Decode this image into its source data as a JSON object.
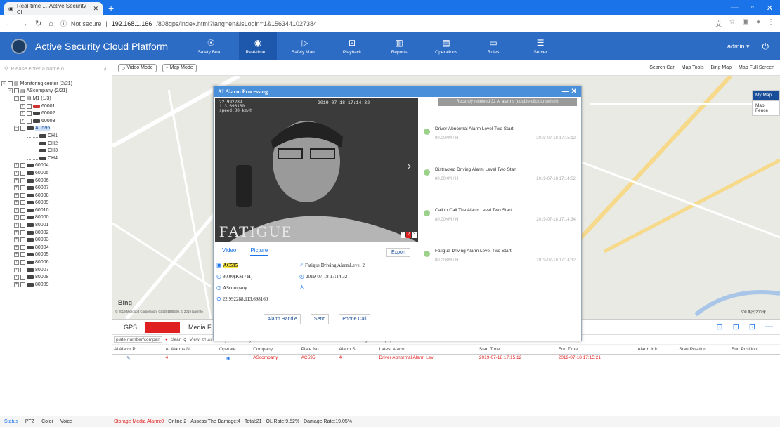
{
  "browser": {
    "tab_title": "Real-time ...-Active Security Cl",
    "url_prefix": "Not secure",
    "url_host": "192.168.1.166",
    "url_path": "/808gps/index.html?lang=en&isLogin=1&1563441027384"
  },
  "app": {
    "title": "Active Security Cloud Platform",
    "user": "admin"
  },
  "nav": [
    {
      "label": "Safety Boa...",
      "icon": "☉"
    },
    {
      "label": "Real-time ...",
      "icon": "◉"
    },
    {
      "label": "Safety Man...",
      "icon": "▷"
    },
    {
      "label": "Playback",
      "icon": "⊡"
    },
    {
      "label": "Reports",
      "icon": "▥"
    },
    {
      "label": "Operations",
      "icon": "▤"
    },
    {
      "label": "Rules",
      "icon": "▭"
    },
    {
      "label": "Server",
      "icon": "☰"
    }
  ],
  "sidebar": {
    "search_placeholder": "Please enter a name o",
    "tree": [
      {
        "t": "Monitoring center (2/21)",
        "lvl": 0,
        "type": "root"
      },
      {
        "t": "AScompany (2/21)",
        "lvl": 1,
        "type": "grp"
      },
      {
        "t": "M1 (1/3)",
        "lvl": 2,
        "type": "grp"
      },
      {
        "t": "60001",
        "lvl": 3,
        "type": "car",
        "red": true
      },
      {
        "t": "60002",
        "lvl": 3,
        "type": "car"
      },
      {
        "t": "60003",
        "lvl": 3,
        "type": "car"
      },
      {
        "t": "AC595",
        "lvl": 2,
        "type": "car",
        "sel": true
      },
      {
        "t": "CH1",
        "lvl": 4,
        "type": "ch"
      },
      {
        "t": "CH2",
        "lvl": 4,
        "type": "ch"
      },
      {
        "t": "CH3",
        "lvl": 4,
        "type": "ch"
      },
      {
        "t": "CH4",
        "lvl": 4,
        "type": "ch"
      },
      {
        "t": "60004",
        "lvl": 2,
        "type": "car"
      },
      {
        "t": "60005",
        "lvl": 2,
        "type": "car"
      },
      {
        "t": "60006",
        "lvl": 2,
        "type": "car"
      },
      {
        "t": "60007",
        "lvl": 2,
        "type": "car"
      },
      {
        "t": "60008",
        "lvl": 2,
        "type": "car"
      },
      {
        "t": "60009",
        "lvl": 2,
        "type": "car"
      },
      {
        "t": "60010",
        "lvl": 2,
        "type": "car"
      },
      {
        "t": "80000",
        "lvl": 2,
        "type": "car"
      },
      {
        "t": "80001",
        "lvl": 2,
        "type": "car"
      },
      {
        "t": "80002",
        "lvl": 2,
        "type": "car"
      },
      {
        "t": "80003",
        "lvl": 2,
        "type": "car"
      },
      {
        "t": "80004",
        "lvl": 2,
        "type": "car"
      },
      {
        "t": "80005",
        "lvl": 2,
        "type": "car"
      },
      {
        "t": "80006",
        "lvl": 2,
        "type": "car"
      },
      {
        "t": "80007",
        "lvl": 2,
        "type": "car"
      },
      {
        "t": "80008",
        "lvl": 2,
        "type": "car"
      },
      {
        "t": "80009",
        "lvl": 2,
        "type": "car"
      }
    ],
    "bottom_tabs": [
      "Status",
      "PTZ",
      "Color",
      "Voice"
    ]
  },
  "maptools": {
    "video_mode": "Video Mode",
    "map_mode": "Map Mode",
    "right": [
      "Search Car",
      "Map Tools",
      "Bing Map",
      "Map Full Screen"
    ],
    "layers": [
      "My Map",
      "Map Fence"
    ],
    "bing": "Bing",
    "copyright": "© 2019 Microsoft Corporation, GS(2018)5600, © 2019 NavInfo",
    "scale": "500 英尺  200 米"
  },
  "bottom": {
    "tabs": [
      "GPS",
      "Alarm Info",
      "Media Files"
    ],
    "filter_placeholder": "plate number/compan",
    "clear": "clear",
    "view": "View",
    "filters": [
      "AI History Processing",
      "AI Alarm Popup",
      "AI Alarm Sound",
      "Face Recognition Popup"
    ],
    "columns": [
      "AI Alarm Pr...",
      "AI Alarms N...",
      "Operate",
      "Company",
      "Plate No.",
      "Alarm S...",
      "Latest Alarm",
      "Start Time",
      "End Time",
      "Alarm Info",
      "Start Position",
      "End Position"
    ],
    "row": {
      "num": "4",
      "company": "AScompany",
      "plate": "AC595",
      "count": "4",
      "latest": "Driver Abnormal Alarm Lev",
      "start": "2019-07-18 17:15:12",
      "end": "2019-07-18 17:15:21"
    }
  },
  "status": {
    "media": "Storage Media Alarm:0",
    "online": "Online:2",
    "assess": "Assess The Damage:4",
    "total": "Total:21",
    "ol": "OL Rate:9.52%",
    "damage": "Damage Rate:19.05%"
  },
  "modal": {
    "title": "AI Alarm Processing",
    "osd_l1": "22.992289",
    "osd_l2": "113.698160",
    "osd_l3": "speed:80 km/h",
    "osd_time": "2019-07-18 17:14:32",
    "overlay": "FATIGUE",
    "pages": [
      "1",
      "2",
      "3"
    ],
    "tab_video": "Video",
    "tab_picture": "Picture",
    "export": "Export",
    "plate": "AC595",
    "alarm": "Fatigue Driving AlarmLevel 2",
    "speed": "80.00(KM / H)",
    "time": "2019-07-18 17:14:32",
    "company": "AScompany",
    "coords": "22.992288,113.698160",
    "btn_handle": "Alarm Handle",
    "btn_send": "Send",
    "btn_call": "Phone Call",
    "list_header": "Recently received 32 AI alarms (double-click to switch)",
    "events": [
      {
        "t": "Driver Abnormal Alarm Level Two Start",
        "s": "80.00KM / H",
        "d": "2019-07-18 17:15:12"
      },
      {
        "t": "Distracted Driving Alarm Level Two Start",
        "s": "80.00KM / H",
        "d": "2019-07-18 17:14:52"
      },
      {
        "t": "Call to Call The Alarm Level Two Start",
        "s": "80.00KM / H",
        "d": "2019-07-18 17:14:34"
      },
      {
        "t": "Fatigue Driving Alarm Level Two Start",
        "s": "80.00KM / H",
        "d": "2019-07-18 17:14:32"
      }
    ]
  },
  "colors": {
    "topbar": "#2d6cc5",
    "accent": "#1a73e8",
    "alarm": "#e02020",
    "plate_highlight": "#ffeb3b"
  }
}
